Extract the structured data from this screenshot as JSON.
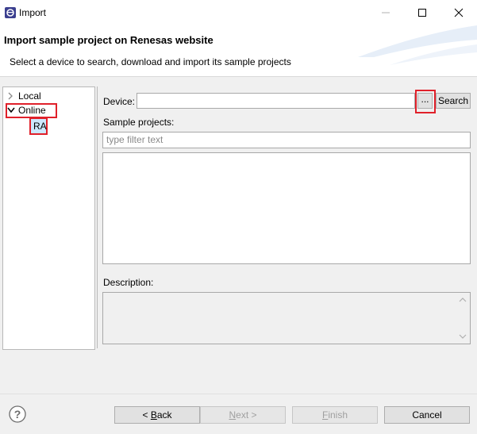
{
  "window": {
    "title": "Import"
  },
  "banner": {
    "title": "Import sample project on Renesas website",
    "subtitle": "Select a device to search, download and import its sample projects"
  },
  "tree": {
    "items": [
      {
        "label": "Local",
        "expanded": false
      },
      {
        "label": "Online",
        "expanded": true
      },
      {
        "label": "RA",
        "selected": true
      }
    ]
  },
  "form": {
    "device_label": "Device:",
    "device_value": "",
    "browse_label": "...",
    "search_label": "Search",
    "samples_label": "Sample projects:",
    "filter_placeholder": "type filter text",
    "description_label": "Description:"
  },
  "footer": {
    "back": {
      "mnemonic": "B",
      "rest": "ack",
      "prefix": "< "
    },
    "next": {
      "mnemonic": "N",
      "rest": "ext",
      "suffix": " >"
    },
    "finish": {
      "mnemonic": "F",
      "rest": "inish"
    },
    "cancel": "Cancel"
  },
  "colors": {
    "highlight": "#e0202a",
    "selection": "#cce8ff",
    "dialog_bg": "#f0f0f0"
  }
}
